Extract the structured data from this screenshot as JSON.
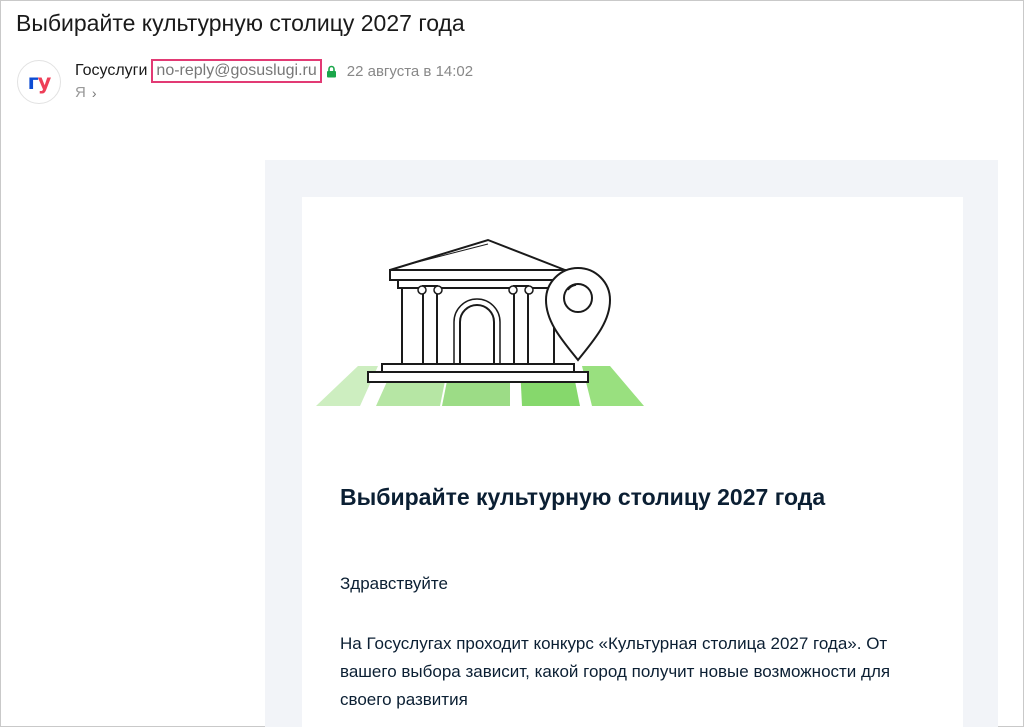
{
  "email": {
    "subject": "Выбирайте культурную столицу 2027 года",
    "avatar": {
      "text_left": "г",
      "text_right": "у",
      "color_left": "#0d4cd3",
      "color_right": "#ee3f58"
    },
    "sender_name": "Госуслуги",
    "sender_email": "no-reply@gosuslugi.ru",
    "verified_icon": "lock-icon",
    "date": "22 августа в 14:02",
    "recipient": "Я",
    "recipient_chevron": "›",
    "highlight_color": "#e23a74"
  },
  "content": {
    "illustration_icon": "museum-with-map-pin-icon",
    "heading": "Выбирайте культурную столицу 2027 года",
    "greeting": "Здравствуйте",
    "paragraph": "На Госуслугах проходит конкурс «Культурная столица 2027 года». От вашего выбора зависит, какой город получит новые возможности для своего развития"
  }
}
